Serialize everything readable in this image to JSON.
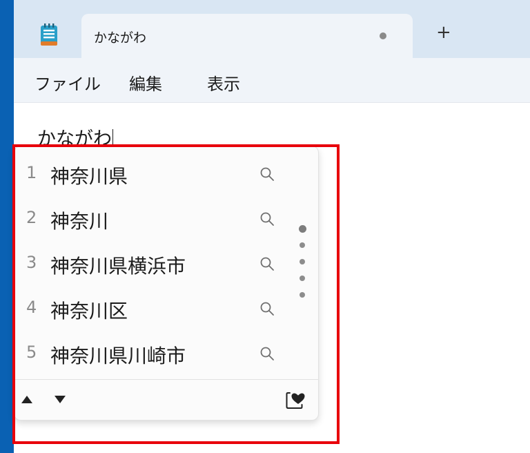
{
  "tab": {
    "title": "かながわ"
  },
  "menu": {
    "file": "ファイル",
    "edit": "編集",
    "view": "表示"
  },
  "new_tab_label": "+",
  "editor": {
    "text": "かながわ"
  },
  "suggestions": [
    {
      "num": "1",
      "word": "神奈川県"
    },
    {
      "num": "2",
      "word": "神奈川"
    },
    {
      "num": "3",
      "word": "神奈川県横浜市"
    },
    {
      "num": "4",
      "word": "神奈川区"
    },
    {
      "num": "5",
      "word": "神奈川県川崎市"
    }
  ],
  "pager": {
    "pages": 5,
    "current": 1
  },
  "icons": {
    "app": "notepad-icon",
    "search": "search-icon",
    "prev": "triangle-up-icon",
    "next": "triangle-down-icon",
    "favorite": "heart-icon"
  },
  "colors": {
    "highlight": "#e8000b",
    "desktop": "#0a61b3",
    "tabbar": "#d9e6f3",
    "menubar": "#f0f4f9"
  }
}
